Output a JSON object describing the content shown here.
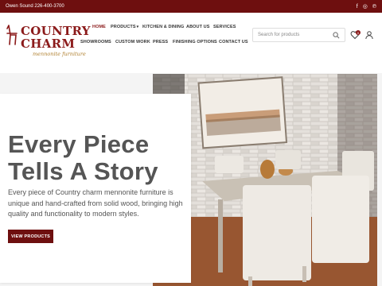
{
  "topbar": {
    "phone": "Owen Sound 226-400-3700",
    "social": [
      {
        "icon": "facebook-icon",
        "glyph": "f"
      },
      {
        "icon": "instagram-icon",
        "glyph": "◎"
      },
      {
        "icon": "pinterest-icon",
        "glyph": "℗"
      }
    ]
  },
  "logo": {
    "line1": "COUNTRY",
    "line2": "CHARM",
    "subtitle": "mennonite furniture"
  },
  "nav": {
    "home": "HOME",
    "products": "PRODUCTS",
    "kitchen": "KITCHEN & DINING",
    "about": "ABOUT US",
    "services": "SERVICES",
    "showrooms": "SHOWROOMS",
    "custom": "CUSTOM WORK",
    "press": "PRESS",
    "finishing": "FINISHING OPTIONS",
    "contact": "CONTACT US",
    "caret": "▾"
  },
  "search": {
    "placeholder": "Search for products"
  },
  "wishlist": {
    "count": "0"
  },
  "hero": {
    "headline_line1": "Every Piece",
    "headline_line2": "Tells A Story",
    "paragraph": "Every piece of Country charm mennonite furniture is unique and hand-crafted from solid wood, bringing high quality and functionality to modern styles.",
    "cta": "VIEW PRODUCTS"
  },
  "colors": {
    "brand": "#6e0f0f",
    "accent": "#8b1a1a",
    "gold": "#b08030"
  }
}
